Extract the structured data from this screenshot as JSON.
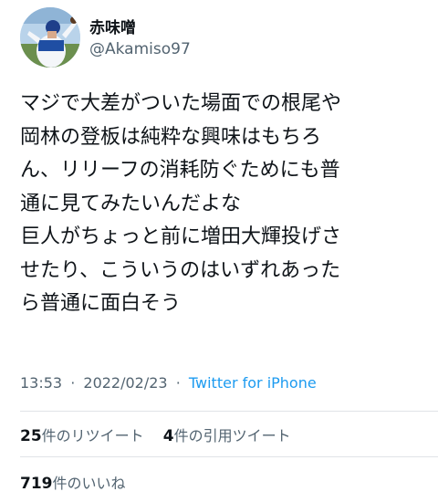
{
  "user": {
    "display_name": "赤味噌",
    "handle": "@Akamiso97"
  },
  "tweet": {
    "lines": [
      "マジで大差がついた場面での根尾や",
      "岡林の登板は純粋な興味はもちろ",
      "ん、リリーフの消耗防ぐためにも普",
      "通に見てみたいんだよな",
      "巨人がちょっと前に増田大輝投げさ",
      "せたり、こういうのはいずれあった",
      "ら普通に面白そう"
    ]
  },
  "meta": {
    "time": "13:53",
    "separator": "·",
    "date": "2022/02/23",
    "source": "Twitter for iPhone"
  },
  "stats": {
    "retweets_count": "25",
    "retweets_label": "件のリツイート",
    "quotes_count": "4",
    "quotes_label": "件の引用ツイート",
    "likes_count": "719",
    "likes_label": "件のいいね"
  },
  "colors": {
    "text": "#0f1419",
    "secondary": "#536471",
    "link": "#1d9bf0",
    "divider": "#e1e4e8"
  }
}
